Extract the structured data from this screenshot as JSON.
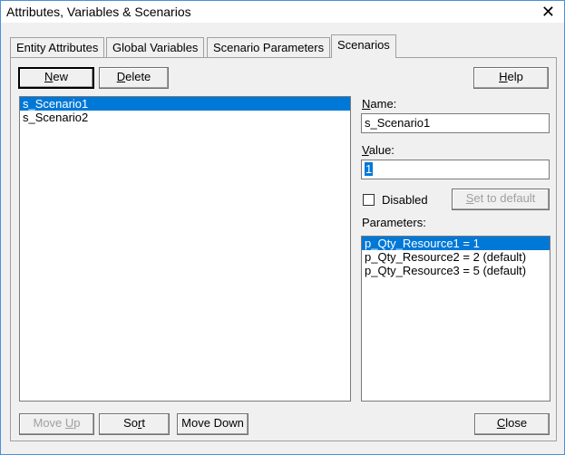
{
  "window": {
    "title": "Attributes, Variables & Scenarios"
  },
  "tabs": [
    {
      "label": "Entity Attributes"
    },
    {
      "label": "Global Variables"
    },
    {
      "label": "Scenario Parameters"
    },
    {
      "label": "Scenarios",
      "active": true
    }
  ],
  "toolbar": {
    "new_mnemonic": "N",
    "new_rest": "ew",
    "delete_mnemonic": "D",
    "delete_rest": "elete",
    "help_mnemonic": "H",
    "help_rest": "elp"
  },
  "scenarios": [
    {
      "name": "s_Scenario1",
      "selected": true
    },
    {
      "name": "s_Scenario2",
      "selected": false
    }
  ],
  "details": {
    "name_label_mnemonic": "N",
    "name_label_rest": "ame:",
    "name_value": "s_Scenario1",
    "value_label_mnemonic": "V",
    "value_label_rest": "alue:",
    "value_value": "1",
    "disabled_label": "Disabled",
    "disabled_checked": false,
    "set_default_mnemonic": "S",
    "set_default_rest": "et to default",
    "parameters_label": "Parameters:"
  },
  "parameters": [
    {
      "text": "p_Qty_Resource1 = 1",
      "selected": true
    },
    {
      "text": "p_Qty_Resource2 = 2 (default)",
      "selected": false
    },
    {
      "text": "p_Qty_Resource3 = 5 (default)",
      "selected": false
    }
  ],
  "footer": {
    "move_up_pre": "Move ",
    "move_up_mnemonic": "U",
    "move_up_rest": "p",
    "sort_pre": "So",
    "sort_mnemonic": "r",
    "sort_rest": "t",
    "move_down_label": "Move Down",
    "close_mnemonic": "C",
    "close_rest": "lose"
  }
}
